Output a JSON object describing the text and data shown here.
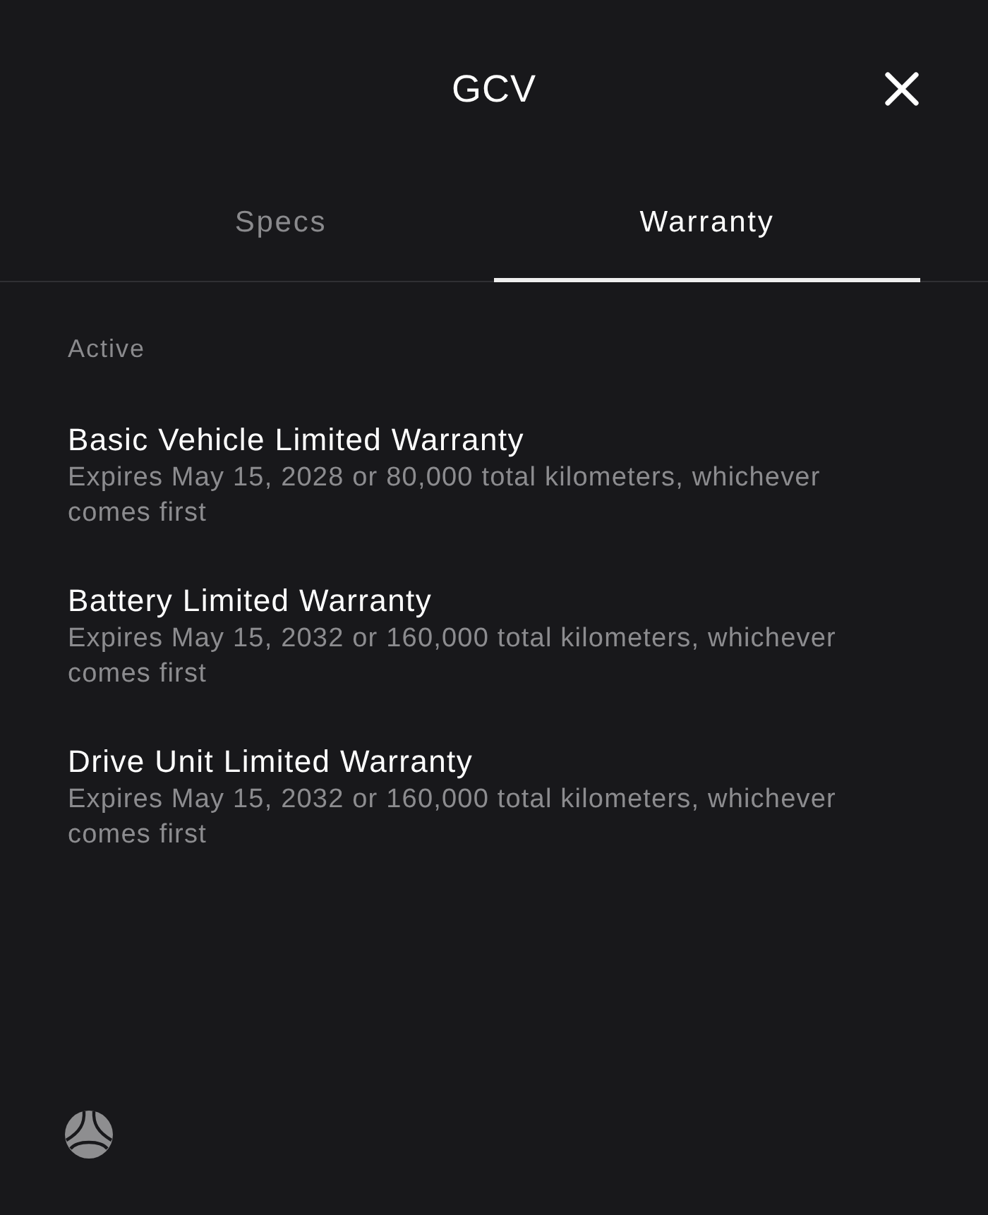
{
  "header": {
    "title": "GCV"
  },
  "tabs": [
    {
      "label": "Specs",
      "selected": false
    },
    {
      "label": "Warranty",
      "selected": true
    }
  ],
  "section": {
    "label": "Active",
    "warranties": [
      {
        "title": "Basic Vehicle Limited Warranty",
        "description": "Expires May 15, 2028 or 80,000 total kilometers, whichever comes first"
      },
      {
        "title": "Battery Limited Warranty",
        "description": "Expires May 15, 2032 or 160,000 total kilometers, whichever comes first"
      },
      {
        "title": "Drive Unit Limited Warranty",
        "description": "Expires May 15, 2032 or 160,000 total kilometers, whichever comes first"
      }
    ]
  }
}
